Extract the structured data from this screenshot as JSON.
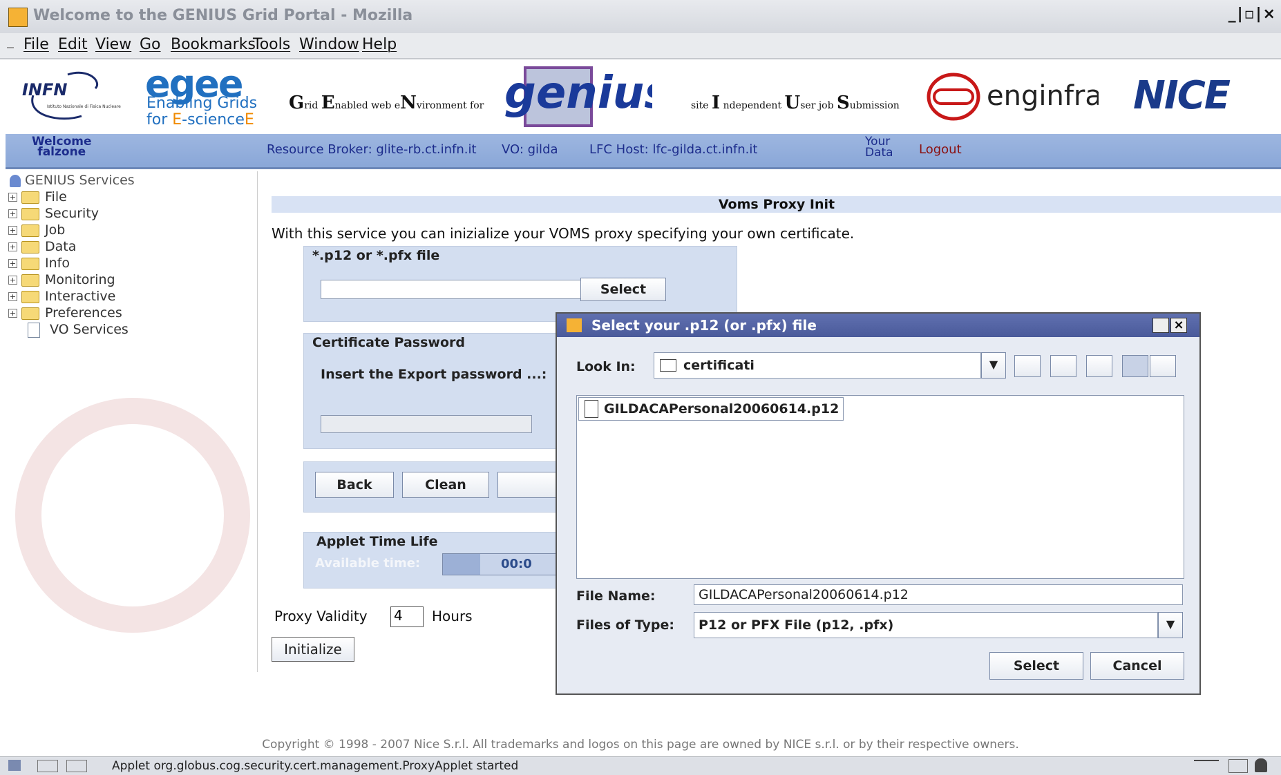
{
  "window": {
    "title": "Welcome to the GENIUS Grid Portal - Mozilla",
    "controls": "_|▫|×"
  },
  "menu": [
    "File",
    "Edit",
    "View",
    "Go",
    "Bookmarks",
    "Tools",
    "Window",
    "Help"
  ],
  "banner": {
    "infn": "INFN",
    "infn_sub": "Istituto Nazionale di Fisica Nucleare",
    "egee": "egee",
    "egee_line1": "Enabling Grids",
    "egee_line2_a": "for ",
    "egee_line2_b": "E",
    "egee_line2_c": "-science",
    "egee_line2_d": "E",
    "grid_G": "G",
    "grid_rid": "rid ",
    "grid_E": "E",
    "grid_nabled": "nabled web e",
    "grid_N": "N",
    "grid_vironment": "vironment for",
    "genius": "genius",
    "site_pre": "site ",
    "site_I": "I",
    "site_ndependent": " ndependent ",
    "site_U": "U",
    "site_ser": "ser job ",
    "site_S": "S",
    "site_ubmission": "ubmission",
    "enginframe": "enginframe",
    "nice": "NICE"
  },
  "infobar": {
    "welcome1": "Welcome",
    "welcome2": "falzone",
    "resource_broker": "Resource Broker: glite-rb.ct.infn.it",
    "vo": "VO: gilda",
    "lfc": "LFC Host: lfc-gilda.ct.infn.it",
    "your1": "Your",
    "your2": "Data",
    "logout": "Logout"
  },
  "sidebar": {
    "root": "GENIUS Services",
    "items": [
      {
        "label": "File"
      },
      {
        "label": "Security"
      },
      {
        "label": "Job"
      },
      {
        "label": "Data"
      },
      {
        "label": "Info"
      },
      {
        "label": "Monitoring"
      },
      {
        "label": "Interactive"
      },
      {
        "label": "Preferences"
      }
    ],
    "leaf": "VO Services"
  },
  "main": {
    "header": "Voms Proxy Init",
    "intro": "With this service you can inizialize your VOMS proxy specifying your own certificate.",
    "p12_label": "*.p12 or *.pfx file",
    "p12_value": "",
    "select_btn": "Select",
    "cert_pw_label": "Certificate Password",
    "export_pw_label": "Insert the Export password ...:",
    "back_btn": "Back",
    "clean_btn": "Clean",
    "applet_label": "Applet Time Life",
    "available_time_label": "Available time:",
    "available_time_value": "00:0",
    "proxy_validity_label": "Proxy Validity",
    "proxy_validity_value": "4",
    "hours_label": "Hours",
    "initialize_btn": "Initialize"
  },
  "dialog": {
    "title": "Select your .p12 (or .pfx) file",
    "look_in_label": "Look In:",
    "look_in_value": "certificati",
    "files": [
      "GILDACAPersonal20060614.p12"
    ],
    "file_name_label": "File Name:",
    "file_name_value": "GILDACAPersonal20060614.p12",
    "files_type_label": "Files of Type:",
    "files_type_value": "P12 or PFX File (p12, .pfx)",
    "select_btn": "Select",
    "cancel_btn": "Cancel"
  },
  "footer": "Copyright © 1998 - 2007 Nice S.r.l. All trademarks and logos on this page are owned by NICE s.r.l. or by their respective owners.",
  "status": "Applet org.globus.cog.security.cert.management.ProxyApplet started"
}
